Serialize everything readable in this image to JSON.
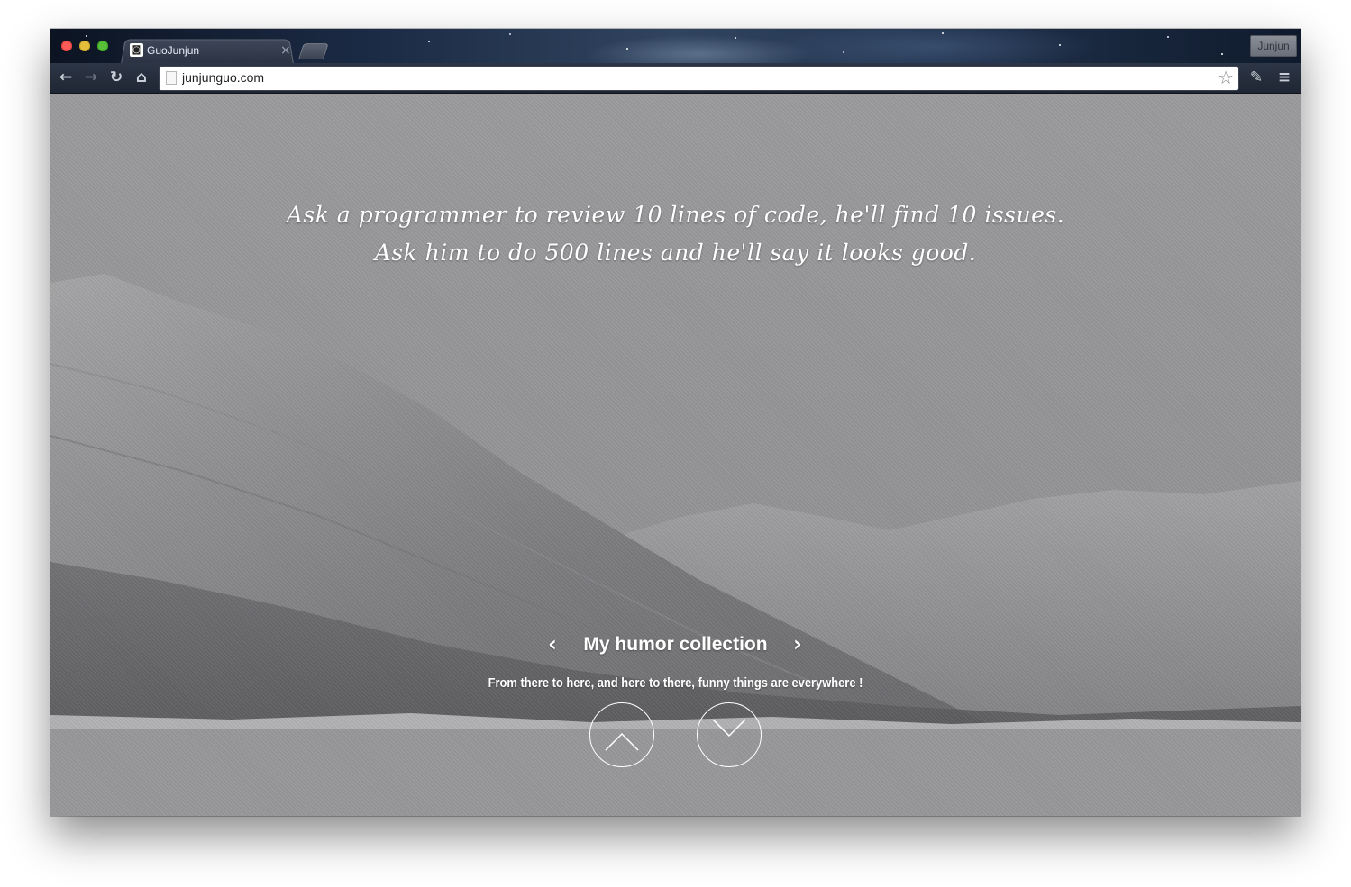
{
  "browser": {
    "tab_title": "GuoJunjun",
    "tab_close": "×",
    "profile_name": "Junjun",
    "url": "junjunguo.com",
    "nav": {
      "back_glyph": "←",
      "forward_glyph": "→",
      "reload_glyph": "↻",
      "home_glyph": "⌂",
      "star_glyph": "☆",
      "extension_glyph": "✎",
      "menu_glyph": "≡"
    }
  },
  "page": {
    "quote_line1": "Ask a programmer to review 10 lines of code, he'll find 10 issues.",
    "quote_line2": "Ask him to do 500 lines and he'll say it looks good.",
    "carousel_title": "My humor collection",
    "prev_glyph": "‹",
    "next_glyph": "›",
    "subtitle": "From there to here, and here to there, funny things are everywhere !"
  },
  "colors": {
    "page_overlay": "#9a9a9c",
    "text": "#ffffff",
    "toolbar": "#2d3646"
  }
}
